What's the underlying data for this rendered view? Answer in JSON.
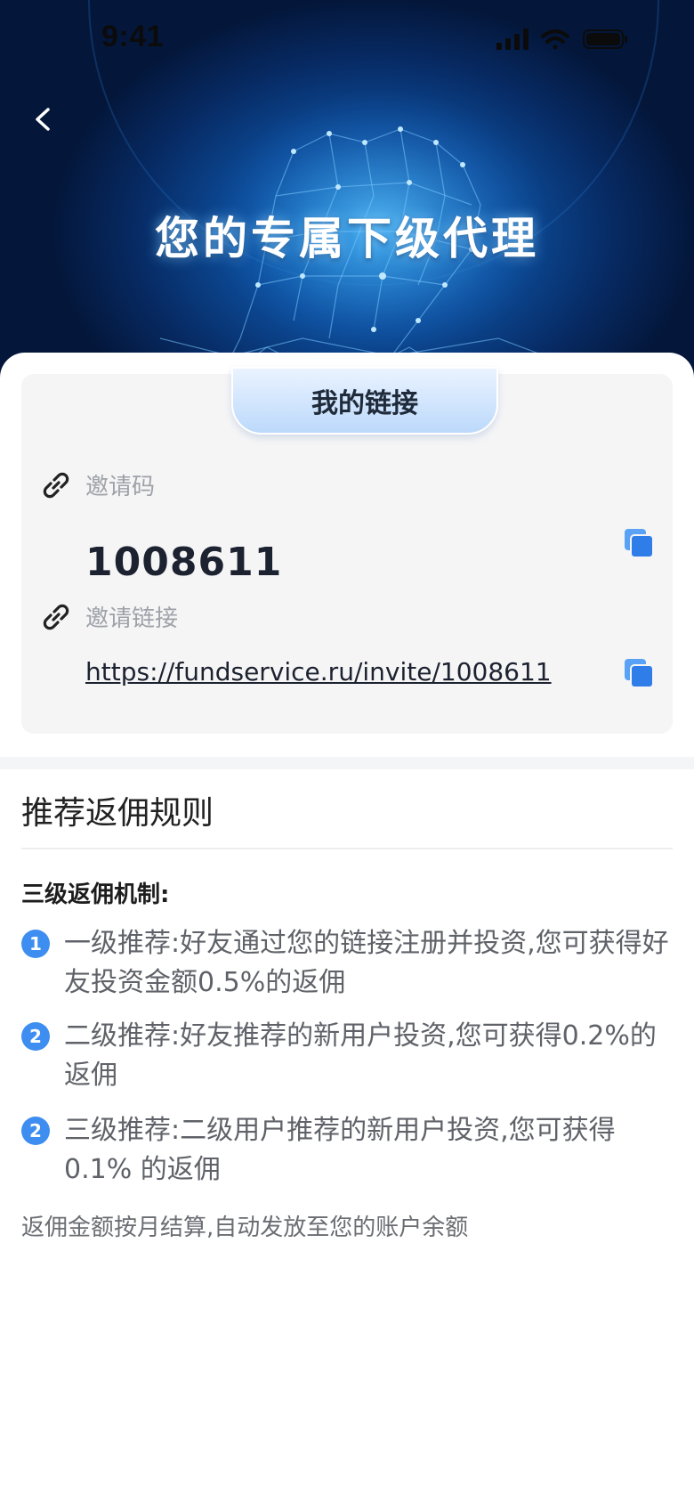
{
  "status_bar": {
    "time": "9:41"
  },
  "hero": {
    "title": "您的专属下级代理"
  },
  "link_card": {
    "tab_label": "我的链接",
    "invite_code_label": "邀请码",
    "invite_code": "1008611",
    "invite_link_label": "邀请链接",
    "invite_link": "https://fundservice.ru/invite/1008611"
  },
  "rules": {
    "title": "推荐返佣规则",
    "mechanism_title": "三级返佣机制:",
    "items": [
      {
        "number": "1",
        "text": "一级推荐:好友通过您的链接注册并投资,您可获得好友投资金额0.5%的返佣"
      },
      {
        "number": "2",
        "text": "二级推荐:好友推荐的新用户投资,您可获得0.2%的返佣"
      },
      {
        "number": "2",
        "text": "三级推荐:二级用户推荐的新用户投资,您可获得0.1% 的返佣"
      }
    ],
    "footnote": "返佣金额按月结算,自动发放至您的账户余额"
  },
  "colors": {
    "accent": "#3d8ef0",
    "hero_dark": "#04173b",
    "hero_glow": "#1d8fe0"
  },
  "icons": [
    "back-arrow",
    "link-chain",
    "copy",
    "signal",
    "wifi",
    "battery"
  ]
}
